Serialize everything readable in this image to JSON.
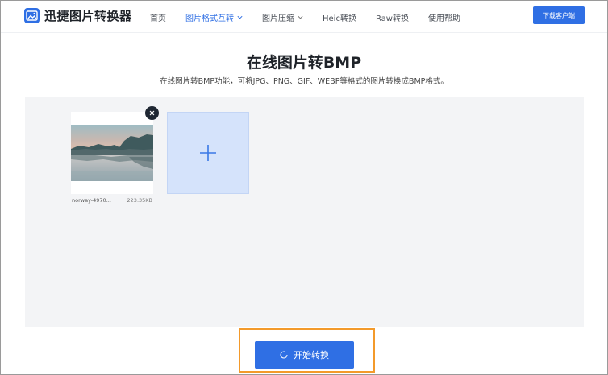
{
  "header": {
    "brand": "迅捷图片转换器",
    "nav": [
      {
        "label": "首页",
        "active": false,
        "dropdown": false
      },
      {
        "label": "图片格式互转",
        "active": true,
        "dropdown": true
      },
      {
        "label": "图片压缩",
        "active": false,
        "dropdown": true
      },
      {
        "label": "Heic转换",
        "active": false,
        "dropdown": false
      },
      {
        "label": "Raw转换",
        "active": false,
        "dropdown": false
      },
      {
        "label": "使用帮助",
        "active": false,
        "dropdown": false
      }
    ],
    "download_button": "下载客户端"
  },
  "main": {
    "title": "在线图片转BMP",
    "subtitle": "在线图片转BMP功能，可将JPG、PNG、GIF、WEBP等格式的图片转换成BMP格式。"
  },
  "upload": {
    "files": [
      {
        "name": "norway-4970...",
        "size": "223.35KB"
      }
    ],
    "add_icon": "plus-icon",
    "remove_icon": "close-icon"
  },
  "actions": {
    "start_label": "开始转换",
    "start_icon": "spinner-icon"
  },
  "colors": {
    "accent": "#2f6fe4",
    "highlight_border": "#f39a2b",
    "panel_bg": "#f3f4f6",
    "add_tile_bg": "#d5e3fb"
  }
}
